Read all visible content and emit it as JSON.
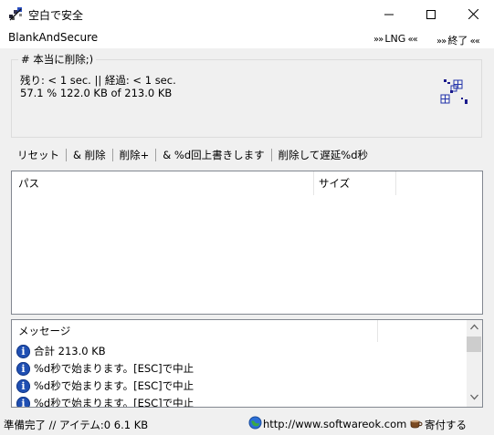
{
  "window": {
    "title": "空白で安全",
    "controls": {
      "minimize": "minimize",
      "maximize": "maximize",
      "close": "close"
    }
  },
  "menu": {
    "app_name": "BlankAndSecure",
    "lng_prefix": "»» ",
    "lng_label": "LNG",
    "lng_suffix": " ««",
    "end_prefix": "»» ",
    "end_label": "終了",
    "end_suffix": " ««"
  },
  "group": {
    "label": "# 本当に削除;)",
    "status_time": "残り: < 1 sec. || 経過: < 1 sec.",
    "status_progress": "57.1 % 122.0 KB of 213.0 KB"
  },
  "toolbar": {
    "reset": "リセット",
    "and_delete": "& 削除",
    "delete_plus": "削除+",
    "overwrite": "& %d回上書きします",
    "delete_delay": "削除して遅延%d秒"
  },
  "filelist": {
    "columns": [
      "パス",
      "サイズ",
      ""
    ]
  },
  "messages": {
    "header": "メッセージ",
    "rows": [
      "合計 213.0 KB",
      "%d秒で始まります。[ESC]で中止",
      "%d秒で始まります。[ESC]で中止",
      "%d秒で始まります。[ESC]で中止"
    ]
  },
  "statusbar": {
    "left": "準備完了 // アイテム:0 6.1 KB",
    "url": "http://www.softwareok.com",
    "donate": "寄付する"
  },
  "colors": {
    "info_icon": "#1f4fb3",
    "border": "#828790",
    "background": "#f0f0f0"
  }
}
